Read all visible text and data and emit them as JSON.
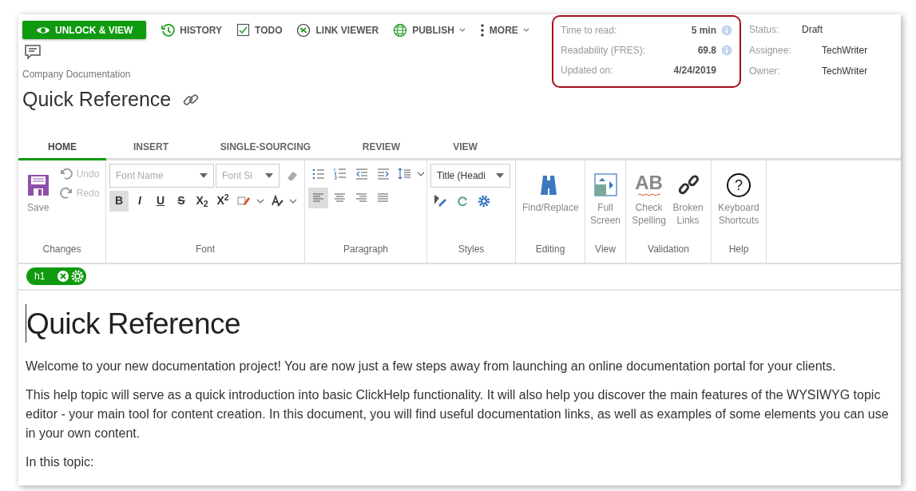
{
  "toolbar": {
    "buttons": [
      {
        "kind": "primary",
        "label": "UNLOCK & VIEW",
        "has_menu": false
      },
      {
        "kind": "plain",
        "label": "HISTORY",
        "has_menu": false
      },
      {
        "kind": "plain",
        "label": "TODO",
        "has_menu": false
      },
      {
        "kind": "plain",
        "label": "LINK VIEWER",
        "has_menu": false
      },
      {
        "kind": "plain",
        "label": "PUBLISH",
        "has_menu": true
      },
      {
        "kind": "plain",
        "label": "MORE",
        "has_menu": true
      }
    ]
  },
  "breadcrumb": "Company Documentation",
  "title": "Quick Reference",
  "stats": [
    {
      "label": "Time to read:",
      "value": "5 min",
      "has_info": true
    },
    {
      "label": "Readability (FRES):",
      "value": "69.8",
      "has_info": true
    },
    {
      "label": "Updated on:",
      "value": "4/24/2019",
      "has_info": false
    }
  ],
  "meta": [
    {
      "label": "Status:",
      "value": "Draft"
    },
    {
      "label": "Assignee:",
      "value": "TechWriter"
    },
    {
      "label": "Owner:",
      "value": "TechWriter"
    }
  ],
  "tabs": [
    {
      "label": "HOME",
      "selected": true
    },
    {
      "label": "INSERT",
      "selected": false
    },
    {
      "label": "SINGLE-SOURCING",
      "selected": false
    },
    {
      "label": "REVIEW",
      "selected": false
    },
    {
      "label": "VIEW",
      "selected": false
    }
  ],
  "ribbon": {
    "groups": [
      {
        "label": "Changes",
        "items": [
          {
            "kind": "large",
            "label": "Save",
            "disabled": false
          },
          {
            "kind": "small",
            "label": "Undo",
            "disabled": true
          },
          {
            "kind": "small",
            "label": "Redo",
            "disabled": true
          }
        ]
      },
      {
        "label": "Font",
        "rows": [
          {
            "items": [
              {
                "kind": "select",
                "placeholder": "Font Name"
              },
              {
                "kind": "select",
                "placeholder": "Font Si"
              },
              {
                "kind": "icon"
              }
            ]
          },
          {
            "items": [
              {
                "kind": "glyph",
                "label": "B",
                "selected": true
              },
              {
                "kind": "glyph",
                "label": "I",
                "selected": false
              },
              {
                "kind": "glyph",
                "label": "U",
                "selected": false
              },
              {
                "kind": "glyph",
                "label": "S",
                "selected": false
              },
              {
                "kind": "glyph",
                "label": "X$_{2}$",
                "selected": false
              },
              {
                "kind": "glyph",
                "label": "X$^{2}$",
                "selected": false
              },
              {
                "kind": "icon"
              },
              {
                "kind": "caret"
              },
              {
                "kind": "icon"
              },
              {
                "kind": "caret"
              }
            ]
          }
        ]
      },
      {
        "label": "Paragraph",
        "rows": [
          {
            "items": [
              {
                "kind": "icon"
              },
              {
                "kind": "icon"
              },
              {
                "kind": "icon"
              },
              {
                "kind": "icon"
              },
              {
                "kind": "icon"
              },
              {
                "kind": "caret"
              }
            ]
          },
          {
            "items": [
              {
                "kind": "icon",
                "selected": true
              },
              {
                "kind": "icon",
                "selected": false
              },
              {
                "kind": "icon",
                "selected": false
              },
              {
                "kind": "icon",
                "selected": false
              }
            ]
          }
        ]
      },
      {
        "label": "Styles",
        "rows": [
          {
            "items": [
              {
                "kind": "select",
                "value": "Title (Headi"
              }
            ]
          },
          {
            "items": [
              {
                "kind": "icon"
              },
              {
                "kind": "icon"
              },
              {
                "kind": "icon"
              }
            ]
          }
        ]
      },
      {
        "label": "Editing",
        "items": [
          {
            "kind": "large",
            "label": "Find/Replace",
            "disabled": false
          }
        ]
      },
      {
        "label": "View",
        "items": [
          {
            "kind": "large",
            "label": "Full Screen",
            "disabled": false
          }
        ]
      },
      {
        "label": "Validation",
        "items": [
          {
            "kind": "large",
            "label": "Check Spelling",
            "icon_text": "AB",
            "disabled": false
          },
          {
            "kind": "large",
            "label": "Broken Links",
            "disabled": false
          }
        ]
      },
      {
        "label": "Help",
        "items": [
          {
            "kind": "large",
            "label": "Keyboard Shortcuts",
            "icon_text": "?",
            "disabled": false
          }
        ]
      }
    ]
  },
  "tag": {
    "label": "h1"
  },
  "document": {
    "heading": "Quick Reference",
    "paragraphs": [
      "Welcome to your new documentation project! You are now just a few steps away from launching an online documentation portal for your clients.",
      "This help topic will serve as a quick introduction into basic ClickHelp functionality. It will also help you discover the main features of the WYSIWYG topic editor - your main tool for content creation. In this document, you will find useful documentation links, as well as examples of some elements you can use in your own content.",
      "In this topic:"
    ]
  }
}
